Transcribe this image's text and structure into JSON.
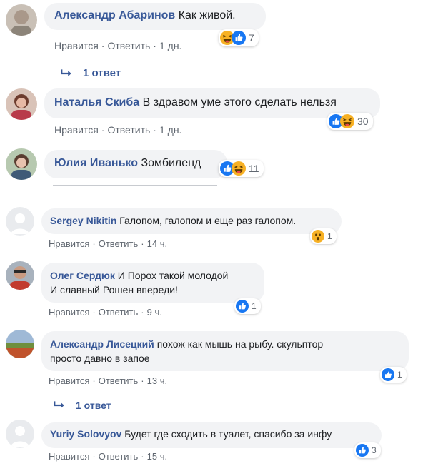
{
  "reply_icon": "reply-arrow-icon",
  "colors": {
    "author": "#385898",
    "bubble": "#f2f3f5",
    "meta": "#606770",
    "like": "#1877f2",
    "haha": "#f7b125"
  },
  "comments": [
    {
      "author": "Александр Абаринов",
      "text": "Как живой.",
      "like": "Нравится",
      "reply": "Ответить",
      "time": "1 дн.",
      "reactions": [
        "haha",
        "like"
      ],
      "count": "7"
    },
    {
      "author": "Наталья Скиба",
      "text": "В здравом уме этого сделать нельзя",
      "like": "Нравится",
      "reply": "Ответить",
      "time": "1 дн.",
      "reactions": [
        "like",
        "haha"
      ],
      "count": "30"
    },
    {
      "author": "Юлия Иванько",
      "text": "Зомбиленд",
      "reactions": [
        "like",
        "haha"
      ],
      "count": "11"
    },
    {
      "author": "Sergey Nikitin",
      "text": "Галопом, галопом и еще раз галопом.",
      "like": "Нравится",
      "reply": "Ответить",
      "time": "14 ч.",
      "reactions": [
        "wow"
      ],
      "count": "1"
    },
    {
      "author": "Олег Сердюк",
      "text_line1": "И Порох такой молодой",
      "text_line2": "И славный Рошен впереди!",
      "like": "Нравится",
      "reply": "Ответить",
      "time": "9 ч.",
      "reactions": [
        "like"
      ],
      "count": "1"
    },
    {
      "author": "Александр Лисецкий",
      "text_line1": "похож как мышь на рыбу. скульптор",
      "text_line2": "просто давно в запое",
      "like": "Нравится",
      "reply": "Ответить",
      "time": "13 ч.",
      "reactions": [
        "like"
      ],
      "count": "1"
    },
    {
      "author": "Yuriy Solovyov",
      "text": "Будет где сходить в туалет, спасибо за инфу",
      "like": "Нравится",
      "reply": "Ответить",
      "time": "15 ч.",
      "reactions": [
        "like"
      ],
      "count": "3"
    }
  ],
  "replies": [
    {
      "label": "1 ответ"
    },
    {
      "label": "1 ответ"
    }
  ]
}
